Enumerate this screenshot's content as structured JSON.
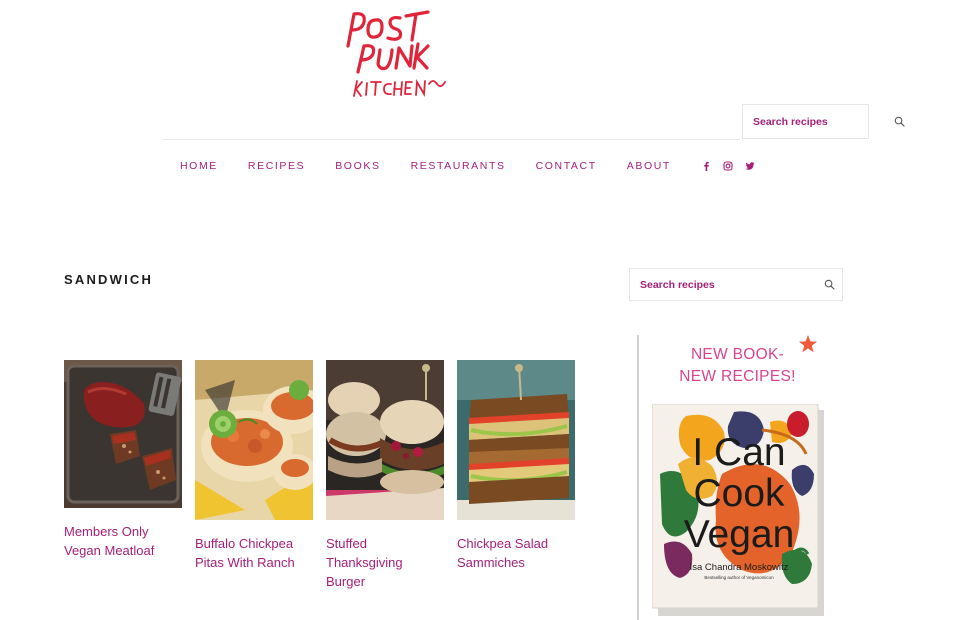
{
  "site": {
    "logo_text": "POST PUNK KITCHEN"
  },
  "header": {
    "search_placeholder": "Search recipes"
  },
  "nav": {
    "items": [
      "HOME",
      "RECIPES",
      "BOOKS",
      "RESTAURANTS",
      "CONTACT",
      "ABOUT"
    ],
    "social_icons": [
      "facebook-icon",
      "instagram-icon",
      "twitter-icon"
    ]
  },
  "archive": {
    "title": "SANDWICH"
  },
  "recipes": [
    {
      "title": "Members Only Vegan Meatloaf"
    },
    {
      "title": "Buffalo Chickpea Pitas With Ranch"
    },
    {
      "title": "Stuffed Thanksgiving Burger"
    },
    {
      "title": "Chickpea Salad Sammiches"
    }
  ],
  "sidebar": {
    "search_placeholder": "Search recipes",
    "promo_line1": "NEW BOOK-",
    "promo_line2": "NEW RECIPES!",
    "book_title": "I Can\nCook\nVegan",
    "book_author": "Isa Chandra Moskowitz",
    "book_tagline": "Bestselling author of Veganomicon"
  },
  "colors": {
    "accent": "#a51f7a",
    "logo": "#e0243a",
    "promo": "#d9438f",
    "star": "#f05a3a"
  }
}
